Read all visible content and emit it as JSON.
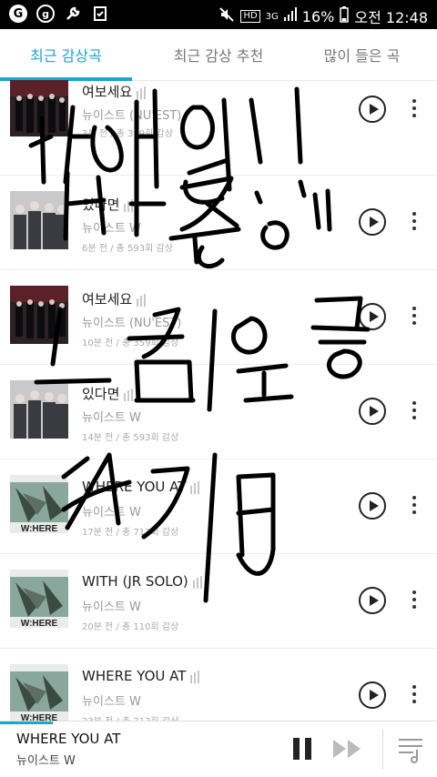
{
  "status_bar": {
    "icons": [
      "g-logo-icon",
      "g-circle-icon",
      "wrench-icon",
      "clipboard-check-icon",
      "mute-icon",
      "signal-icon",
      "battery-icon"
    ],
    "hd": "HD",
    "network": "3G",
    "battery": "16%",
    "time": "오전 12:48"
  },
  "tabs": [
    {
      "label": "최근 감상곡",
      "active": true
    },
    {
      "label": "최근 감상 추천",
      "active": false
    },
    {
      "label": "많이 들은 곡",
      "active": false
    }
  ],
  "accent_color": "#1ba5cf",
  "tracks": [
    {
      "title": "여보세요",
      "artist": "뉴이스트 (NU'EST)",
      "meta": "3분 전 / 총 359회 감상",
      "art": "dark"
    },
    {
      "title": "있다면",
      "artist": "뉴이스트 W",
      "meta": "6분 전 / 총 593회 감상",
      "art": "grey"
    },
    {
      "title": "여보세요",
      "artist": "뉴이스트 (NU'EST)",
      "meta": "10분 전 / 총 359회 감상",
      "art": "dark"
    },
    {
      "title": "있다면",
      "artist": "뉴이스트 W",
      "meta": "14분 전 / 총 593회 감상",
      "art": "grey"
    },
    {
      "title": "WHERE YOU AT",
      "artist": "뉴이스트 W",
      "meta": "17분 전 / 총 713회 감상",
      "art": "where"
    },
    {
      "title": "WITH (JR SOLO)",
      "artist": "뉴이스트 W",
      "meta": "20분 전 / 총 110회 감상",
      "art": "where"
    },
    {
      "title": "WHERE YOU AT",
      "artist": "뉴이스트 W",
      "meta": "23분 전 / 총 713회 감상",
      "art": "where"
    }
  ],
  "now_playing": {
    "title": "WHERE YOU AT",
    "artist": "뉴이스트 W",
    "progress": 0.12
  },
  "handwriting": [
    "이제 민",
    "혁 둥이",
    "1 생 인증",
    "7/18"
  ]
}
